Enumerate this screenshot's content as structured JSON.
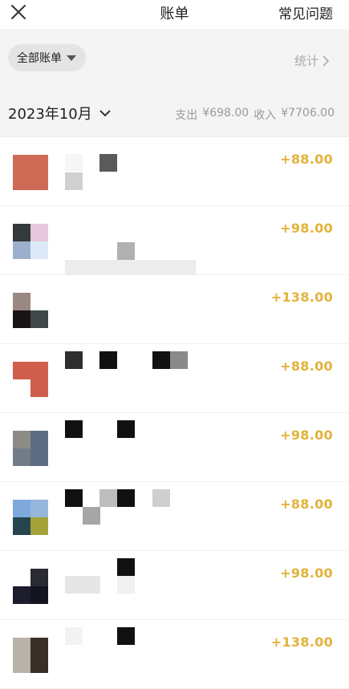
{
  "header": {
    "title": "账单",
    "faq_label": "常见问题"
  },
  "filter": {
    "chip_label": "全部账单",
    "stats_label": "统计"
  },
  "month": {
    "label": "2023年10月",
    "expense_label": "支出",
    "expense_value": "¥698.00",
    "income_label": "收入",
    "income_value": "¥7706.00"
  },
  "colors": {
    "accent_amount": "#e2b23a",
    "strip_bg": "#f4f4f4"
  },
  "icons": {
    "close": "close-icon",
    "chip_arrow": "caret-down-icon",
    "stats_arrow": "chevron-right-icon",
    "month_arrow": "chevron-down-icon"
  },
  "transactions": [
    {
      "amount": "+88.00",
      "icon_colors": [
        "#cf6a56",
        "#cf6a56",
        "#cf6a56",
        "#cf6a56"
      ]
    },
    {
      "amount": "+98.00",
      "icon_colors": [
        "#343a3b",
        "#e6c6da",
        "#9cb0cd",
        "#dde9f6"
      ]
    },
    {
      "amount": "+138.00",
      "icon_colors": [
        "#9a8882",
        "#ffffff",
        "#1a1414",
        "#3f4747"
      ]
    },
    {
      "amount": "+88.00",
      "icon_colors": [
        "#cf5e4c",
        "#cf5e4c",
        "#ffffff",
        "#cf5e4c"
      ]
    },
    {
      "amount": "+98.00",
      "icon_colors": [
        "#8c8c86",
        "#5e6c82",
        "#737c86",
        "#5e6c82"
      ]
    },
    {
      "amount": "+88.00",
      "icon_colors": [
        "#7fa8dc",
        "#97b6dc",
        "#25454f",
        "#a3a33a"
      ]
    },
    {
      "amount": "+98.00",
      "icon_colors": [
        "#ffffff",
        "#2a2a33",
        "#1c1c2e",
        "#141420"
      ]
    },
    {
      "amount": "+138.00",
      "icon_colors": [
        "#b9b2aa",
        "#3a2f28",
        "#b9b2aa",
        "#3a2f28"
      ]
    }
  ]
}
